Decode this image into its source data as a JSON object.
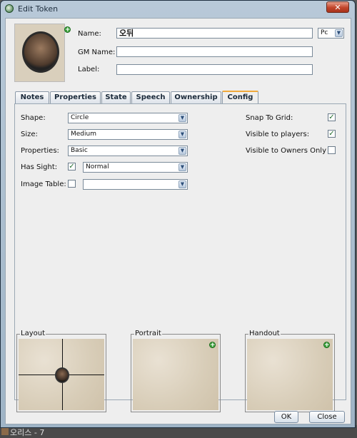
{
  "window": {
    "title": "Edit Token",
    "close_label": "✕"
  },
  "header": {
    "name_label": "Name:",
    "name_value": "오뒤",
    "type_value": "Pc",
    "gm_name_label": "GM Name:",
    "gm_name_value": "",
    "label_label": "Label:",
    "label_value": ""
  },
  "tabs": [
    "Notes",
    "Properties",
    "State",
    "Speech",
    "Ownership",
    "Config"
  ],
  "config": {
    "shape_label": "Shape:",
    "shape_value": "Circle",
    "size_label": "Size:",
    "size_value": "Medium",
    "properties_label": "Properties:",
    "properties_value": "Basic",
    "has_sight_label": "Has Sight:",
    "sight_value": "Normal",
    "image_table_label": "Image Table:",
    "image_table_value": "",
    "snap_label": "Snap To Grid:",
    "visible_players_label": "Visible to players:",
    "visible_owners_label": "Visible to Owners Only",
    "has_sight_checked": true,
    "image_table_checked": false,
    "snap_checked": true,
    "visible_players_checked": true,
    "visible_owners_checked": false
  },
  "groups": {
    "layout": "Layout",
    "portrait": "Portrait",
    "handout": "Handout"
  },
  "buttons": {
    "ok": "OK",
    "close": "Close"
  },
  "background": {
    "chat_text": "오리스 - 7"
  },
  "icons": {
    "app": "maptool-icon",
    "add": "plus-icon",
    "dropdown": "chevron-down-icon",
    "check": "checkmark"
  }
}
